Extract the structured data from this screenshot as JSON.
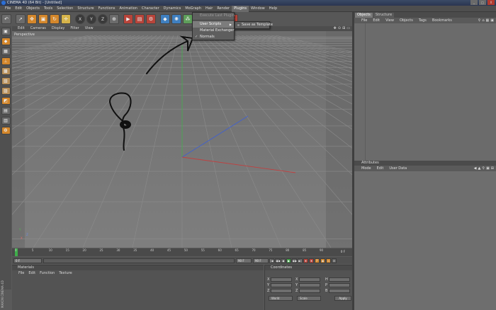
{
  "window": {
    "title": "CINEMA 4D (64 Bit) - [Untitled]",
    "controls": [
      "_",
      "□",
      "X"
    ]
  },
  "menubar": [
    "File",
    "Edit",
    "Objects",
    "Tools",
    "Selection",
    "Structure",
    "Functions",
    "Animation",
    "Character",
    "Dynamics",
    "MoGraph",
    "Hair",
    "Render",
    "Plugins",
    "Window",
    "Help"
  ],
  "active_menu": "Plugins",
  "plugins_menu": {
    "items": [
      {
        "label": "Execute Last Plugin",
        "disabled": true
      },
      {
        "label": "User Scripts",
        "has_submenu": true,
        "highlighted": true
      },
      {
        "label": "Material Exchanger"
      },
      {
        "label": "Normals",
        "checked": true
      }
    ],
    "submenu": [
      {
        "label": "Save as Template"
      }
    ]
  },
  "toolbar_icons": [
    "undo-icon",
    "select-icon",
    "move-icon",
    "scale-icon",
    "rotate-icon",
    "recent-tool-icon",
    "x-axis-icon",
    "y-axis-icon",
    "z-axis-icon",
    "coordinate-system-icon",
    "render-view-icon",
    "render-picture-viewer-icon",
    "render-settings-icon",
    "cube-icon",
    "subdivision-icon",
    "array-icon",
    "deformer-icon",
    "scene-icon",
    "camera-icon",
    "light-icon"
  ],
  "toolbar_glyphs": {
    "x": "X",
    "y": "Y",
    "z": "Z"
  },
  "viewport": {
    "menu": [
      "Edit",
      "Cameras",
      "Display",
      "Filter",
      "View"
    ],
    "label": "Perspective",
    "nav": [
      "✥",
      "⊙",
      "⊞",
      "▭"
    ],
    "background": "#7a7a7a",
    "axis_gizmo": {
      "x": "X",
      "y": "Y",
      "z": "Z"
    }
  },
  "timeline": {
    "ticks": [
      "0",
      "5",
      "10",
      "15",
      "20",
      "25",
      "30",
      "35",
      "40",
      "45",
      "50",
      "55",
      "60",
      "65",
      "70",
      "75",
      "80",
      "85",
      "90"
    ],
    "current_frame": "0 F"
  },
  "transport": {
    "start_field": "0 F",
    "end_field": "90 F",
    "end_field_2": "90 F",
    "buttons": [
      "|◀",
      "◀◀",
      "◀",
      "▶",
      "▶▶",
      "▶|",
      "⏺",
      "⏺",
      "P",
      "◆",
      "⊙",
      "⊟"
    ]
  },
  "materials": {
    "title": "Materials",
    "menu": [
      "File",
      "Edit",
      "Function",
      "Texture"
    ]
  },
  "coordinates": {
    "title": "Coordinates",
    "rows": [
      {
        "a": "X",
        "b": "X",
        "c": "H"
      },
      {
        "a": "Y",
        "b": "Y",
        "c": "P"
      },
      {
        "a": "Z",
        "b": "Z",
        "c": "B"
      }
    ],
    "mode_select": "World",
    "size_select": "Scale",
    "apply_label": "Apply"
  },
  "objects_panel": {
    "tabs": [
      "Objects",
      "Structure"
    ],
    "menu": [
      "File",
      "Edit",
      "View",
      "Objects",
      "Tags",
      "Bookmarks"
    ],
    "icons": [
      "search-icon",
      "home-icon",
      "grid-icon",
      "lock-icon"
    ],
    "icon_glyphs": [
      "⚲",
      "⌂",
      "▦",
      "▣"
    ]
  },
  "attributes_panel": {
    "title": "Attributes",
    "menu": [
      "Mode",
      "Edit",
      "User Data"
    ],
    "icons": [
      "back-icon",
      "up-icon",
      "search-icon",
      "lock-icon",
      "add-icon"
    ],
    "icon_glyphs": [
      "◀",
      "▲",
      "⚲",
      "▣",
      "⊞"
    ]
  },
  "brand": "MAXON CINEMA 4D",
  "colors": {
    "ui_dark": "#4e4e4e",
    "viewport_bg": "#7a7a7a",
    "accent_orange": "#d4872b",
    "timeline_green": "#3fae4a",
    "axis_x": "#c04040",
    "axis_y": "#40b040",
    "axis_z": "#4060d0"
  }
}
